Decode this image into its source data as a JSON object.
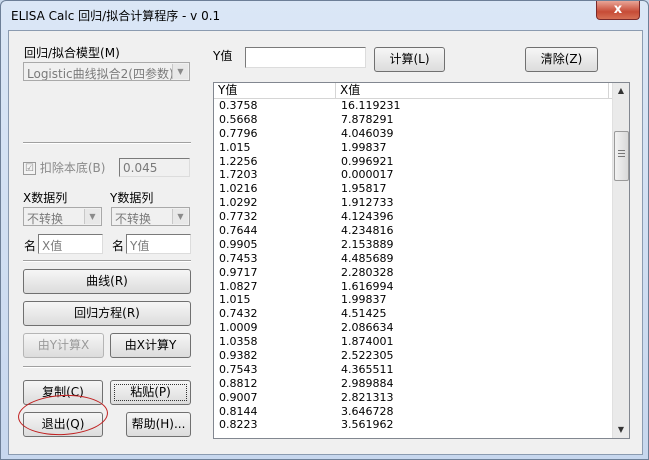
{
  "window": {
    "title": "ELISA Calc 回归/拟合计算程序 - v 0.1",
    "close_label": "x"
  },
  "model": {
    "label": "回归/拟合模型(M)",
    "selected": "Logistic曲线拟合2(四参数)"
  },
  "baseline": {
    "checkbox_label": "扣除本底(B)",
    "checked": "☑",
    "value": "0.045"
  },
  "x_column": {
    "label": "X数据列",
    "selected": "不转换",
    "name_label": "名",
    "name_value": "X值"
  },
  "y_column": {
    "label": "Y数据列",
    "selected": "不转换",
    "name_label": "名",
    "name_value": "Y值"
  },
  "buttons": {
    "curve": "曲线(R)",
    "regression_equation": "回归方程(R)",
    "calc_by_y": "由Y计算X",
    "calc_by_x": "由X计算Y",
    "copy": "复制(C)",
    "paste": "粘贴(P)",
    "exit": "退出(Q)",
    "help": "帮助(H)...",
    "calculate": "计算(L)",
    "clear": "清除(Z)"
  },
  "y_input": {
    "label": "Y值",
    "value": ""
  },
  "table": {
    "columns": [
      "Y值",
      "X值"
    ],
    "rows": [
      [
        "0.3758",
        "16.119231"
      ],
      [
        "0.5668",
        "7.878291"
      ],
      [
        "0.7796",
        "4.046039"
      ],
      [
        "1.015",
        "1.99837"
      ],
      [
        "1.2256",
        "0.996921"
      ],
      [
        "1.7203",
        "0.000017"
      ],
      [
        "1.0216",
        "1.95817"
      ],
      [
        "1.0292",
        "1.912733"
      ],
      [
        "0.7732",
        "4.124396"
      ],
      [
        "0.7644",
        "4.234816"
      ],
      [
        "0.9905",
        "2.153889"
      ],
      [
        "0.7453",
        "4.485689"
      ],
      [
        "0.9717",
        "2.280328"
      ],
      [
        "1.0827",
        "1.616994"
      ],
      [
        "1.015",
        "1.99837"
      ],
      [
        "0.7432",
        "4.51425"
      ],
      [
        "1.0009",
        "2.086634"
      ],
      [
        "1.0358",
        "1.874001"
      ],
      [
        "0.9382",
        "2.522305"
      ],
      [
        "0.7543",
        "4.365511"
      ],
      [
        "0.8812",
        "2.989884"
      ],
      [
        "0.9007",
        "2.821313"
      ],
      [
        "0.8144",
        "3.646728"
      ],
      [
        "0.8223",
        "3.561962"
      ]
    ]
  },
  "colors": {
    "annotation": "#c02020"
  }
}
